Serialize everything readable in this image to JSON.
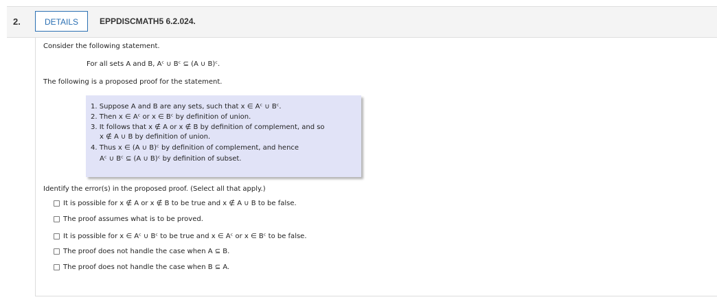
{
  "header": {
    "number": "2.",
    "details_label": "DETAILS",
    "title": "EPPDISCMATH5 6.2.024."
  },
  "body": {
    "intro": "Consider the following statement.",
    "statement": "For all sets A and B, Aᶜ ∪ Bᶜ ⊆ (A ∪ B)ᶜ.",
    "proof_intro": "The following is a proposed proof for the statement.",
    "proof_lines": [
      "1. Suppose A and B are any sets, such that x ∈ Aᶜ ∪ Bᶜ.",
      "2. Then x ∈ Aᶜ or x ∈ Bᶜ by definition of union.",
      "3. It follows that x ∉ A or x ∉ B by definition of complement, and so",
      "x ∉ A ∪ B by definition of union.",
      "4. Thus x ∈ (A ∪ B)ᶜ by definition of complement, and hence",
      "Aᶜ ∪ Bᶜ ⊆ (A ∪ B)ᶜ by definition of subset."
    ],
    "prompt": "Identify the error(s) in the proposed proof. (Select all that apply.)",
    "options": [
      "It is possible for x ∉ A or x ∉ B to be true and x ∉ A ∪ B to be false.",
      "The proof assumes what is to be proved.",
      "It is possible for x ∈ Aᶜ ∪ Bᶜ to be true and x ∈ Aᶜ or x ∈ Bᶜ to be false.",
      "The proof does not handle the case when A ⊆ B.",
      "The proof does not handle the case when B ⊆ A."
    ]
  },
  "colors": {
    "accent": "#2a6fb3",
    "proof_background": "#e1e3f7",
    "header_background": "#f4f4f4"
  }
}
